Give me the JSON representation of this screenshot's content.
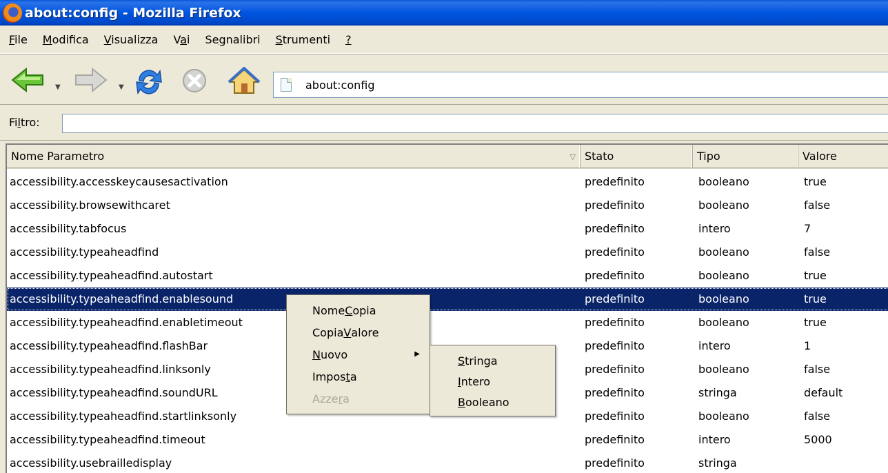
{
  "window": {
    "title": "about:config - Mozilla Firefox"
  },
  "menubar": {
    "items": [
      {
        "pre": "",
        "key": "F",
        "post": "ile"
      },
      {
        "pre": "",
        "key": "M",
        "post": "odifica"
      },
      {
        "pre": "",
        "key": "V",
        "post": "isualizza"
      },
      {
        "pre": "V",
        "key": "a",
        "post": "i"
      },
      {
        "pre": "Se",
        "key": "g",
        "post": "nalibri"
      },
      {
        "pre": "",
        "key": "S",
        "post": "trumenti"
      },
      {
        "pre": "",
        "key": "?",
        "post": ""
      }
    ]
  },
  "toolbar": {
    "back_icon": "back-arrow-icon",
    "forward_icon": "forward-arrow-icon",
    "reload_icon": "reload-icon",
    "stop_icon": "stop-icon",
    "home_icon": "home-icon",
    "url": "about:config"
  },
  "filter": {
    "label_pre": "Fi",
    "label_key": "l",
    "label_post": "tro:",
    "value": ""
  },
  "table": {
    "headers": {
      "name": "Nome Parametro",
      "status": "Stato",
      "type": "Tipo",
      "value": "Valore"
    },
    "rows": [
      {
        "name": "accessibility.accesskeycausesactivation",
        "status": "predefinito",
        "type": "booleano",
        "value": "true"
      },
      {
        "name": "accessibility.browsewithcaret",
        "status": "predefinito",
        "type": "booleano",
        "value": "false"
      },
      {
        "name": "accessibility.tabfocus",
        "status": "predefinito",
        "type": "intero",
        "value": "7"
      },
      {
        "name": "accessibility.typeaheadfind",
        "status": "predefinito",
        "type": "booleano",
        "value": "false"
      },
      {
        "name": "accessibility.typeaheadfind.autostart",
        "status": "predefinito",
        "type": "booleano",
        "value": "true"
      },
      {
        "name": "accessibility.typeaheadfind.enablesound",
        "status": "predefinito",
        "type": "booleano",
        "value": "true"
      },
      {
        "name": "accessibility.typeaheadfind.enabletimeout",
        "status": "predefinito",
        "type": "booleano",
        "value": "true"
      },
      {
        "name": "accessibility.typeaheadfind.flashBar",
        "status": "predefinito",
        "type": "intero",
        "value": "1"
      },
      {
        "name": "accessibility.typeaheadfind.linksonly",
        "status": "predefinito",
        "type": "booleano",
        "value": "false"
      },
      {
        "name": "accessibility.typeaheadfind.soundURL",
        "status": "predefinito",
        "type": "stringa",
        "value": "default"
      },
      {
        "name": "accessibility.typeaheadfind.startlinksonly",
        "status": "predefinito",
        "type": "booleano",
        "value": "false"
      },
      {
        "name": "accessibility.typeaheadfind.timeout",
        "status": "predefinito",
        "type": "intero",
        "value": "5000"
      },
      {
        "name": "accessibility.usebrailledisplay",
        "status": "predefinito",
        "type": "stringa",
        "value": ""
      }
    ]
  },
  "context_menu": {
    "items": [
      {
        "pre": "Nome ",
        "key": "C",
        "post": "opia"
      },
      {
        "pre": "Copia ",
        "key": "V",
        "post": "alore"
      },
      {
        "pre": "",
        "key": "N",
        "post": "uovo"
      },
      {
        "pre": "Impos",
        "key": "t",
        "post": "a"
      },
      {
        "pre": "Azze",
        "key": "r",
        "post": "a"
      }
    ],
    "submenu": [
      {
        "pre": "",
        "key": "S",
        "post": "tringa"
      },
      {
        "pre": "",
        "key": "I",
        "post": "ntero"
      },
      {
        "pre": "",
        "key": "B",
        "post": "ooleano"
      }
    ]
  }
}
